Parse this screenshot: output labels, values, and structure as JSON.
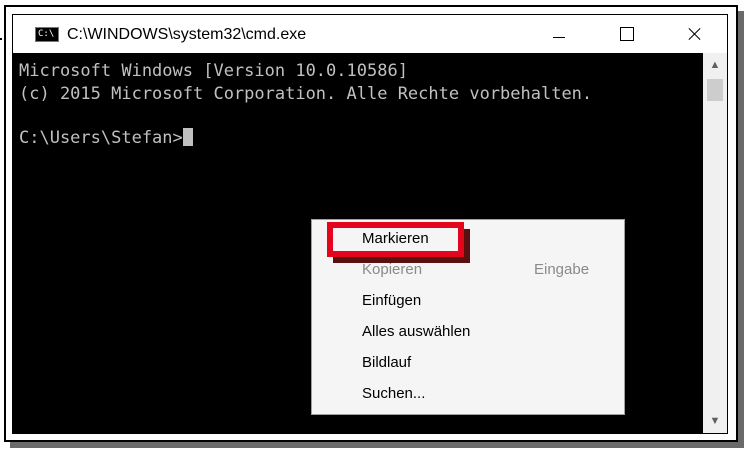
{
  "window": {
    "title": "C:\\WINDOWS\\system32\\cmd.exe",
    "icon": "cmd-icon",
    "controls": {
      "minimize": "minimize-icon",
      "maximize": "maximize-icon",
      "close": "close-icon"
    }
  },
  "console": {
    "lines": [
      "Microsoft Windows [Version 10.0.10586]",
      "(c) 2015 Microsoft Corporation. Alle Rechte vorbehalten.",
      "C:\\Users\\Stefan>"
    ],
    "text_color": "#c0c0c0",
    "background": "#000000"
  },
  "scrollbar": {
    "up": "▲",
    "down": "▼"
  },
  "context_menu": {
    "items": [
      {
        "label": "Markieren",
        "enabled": true
      },
      {
        "label": "Kopieren",
        "enabled": false,
        "shortcut": "Eingabe"
      },
      {
        "label": "Einfügen",
        "enabled": true
      },
      {
        "label": "Alles auswählen",
        "enabled": true
      },
      {
        "label": "Bildlauf",
        "enabled": true
      },
      {
        "label": "Suchen...",
        "enabled": true
      }
    ]
  },
  "annotation": {
    "highlight_color": "#e3051b"
  }
}
